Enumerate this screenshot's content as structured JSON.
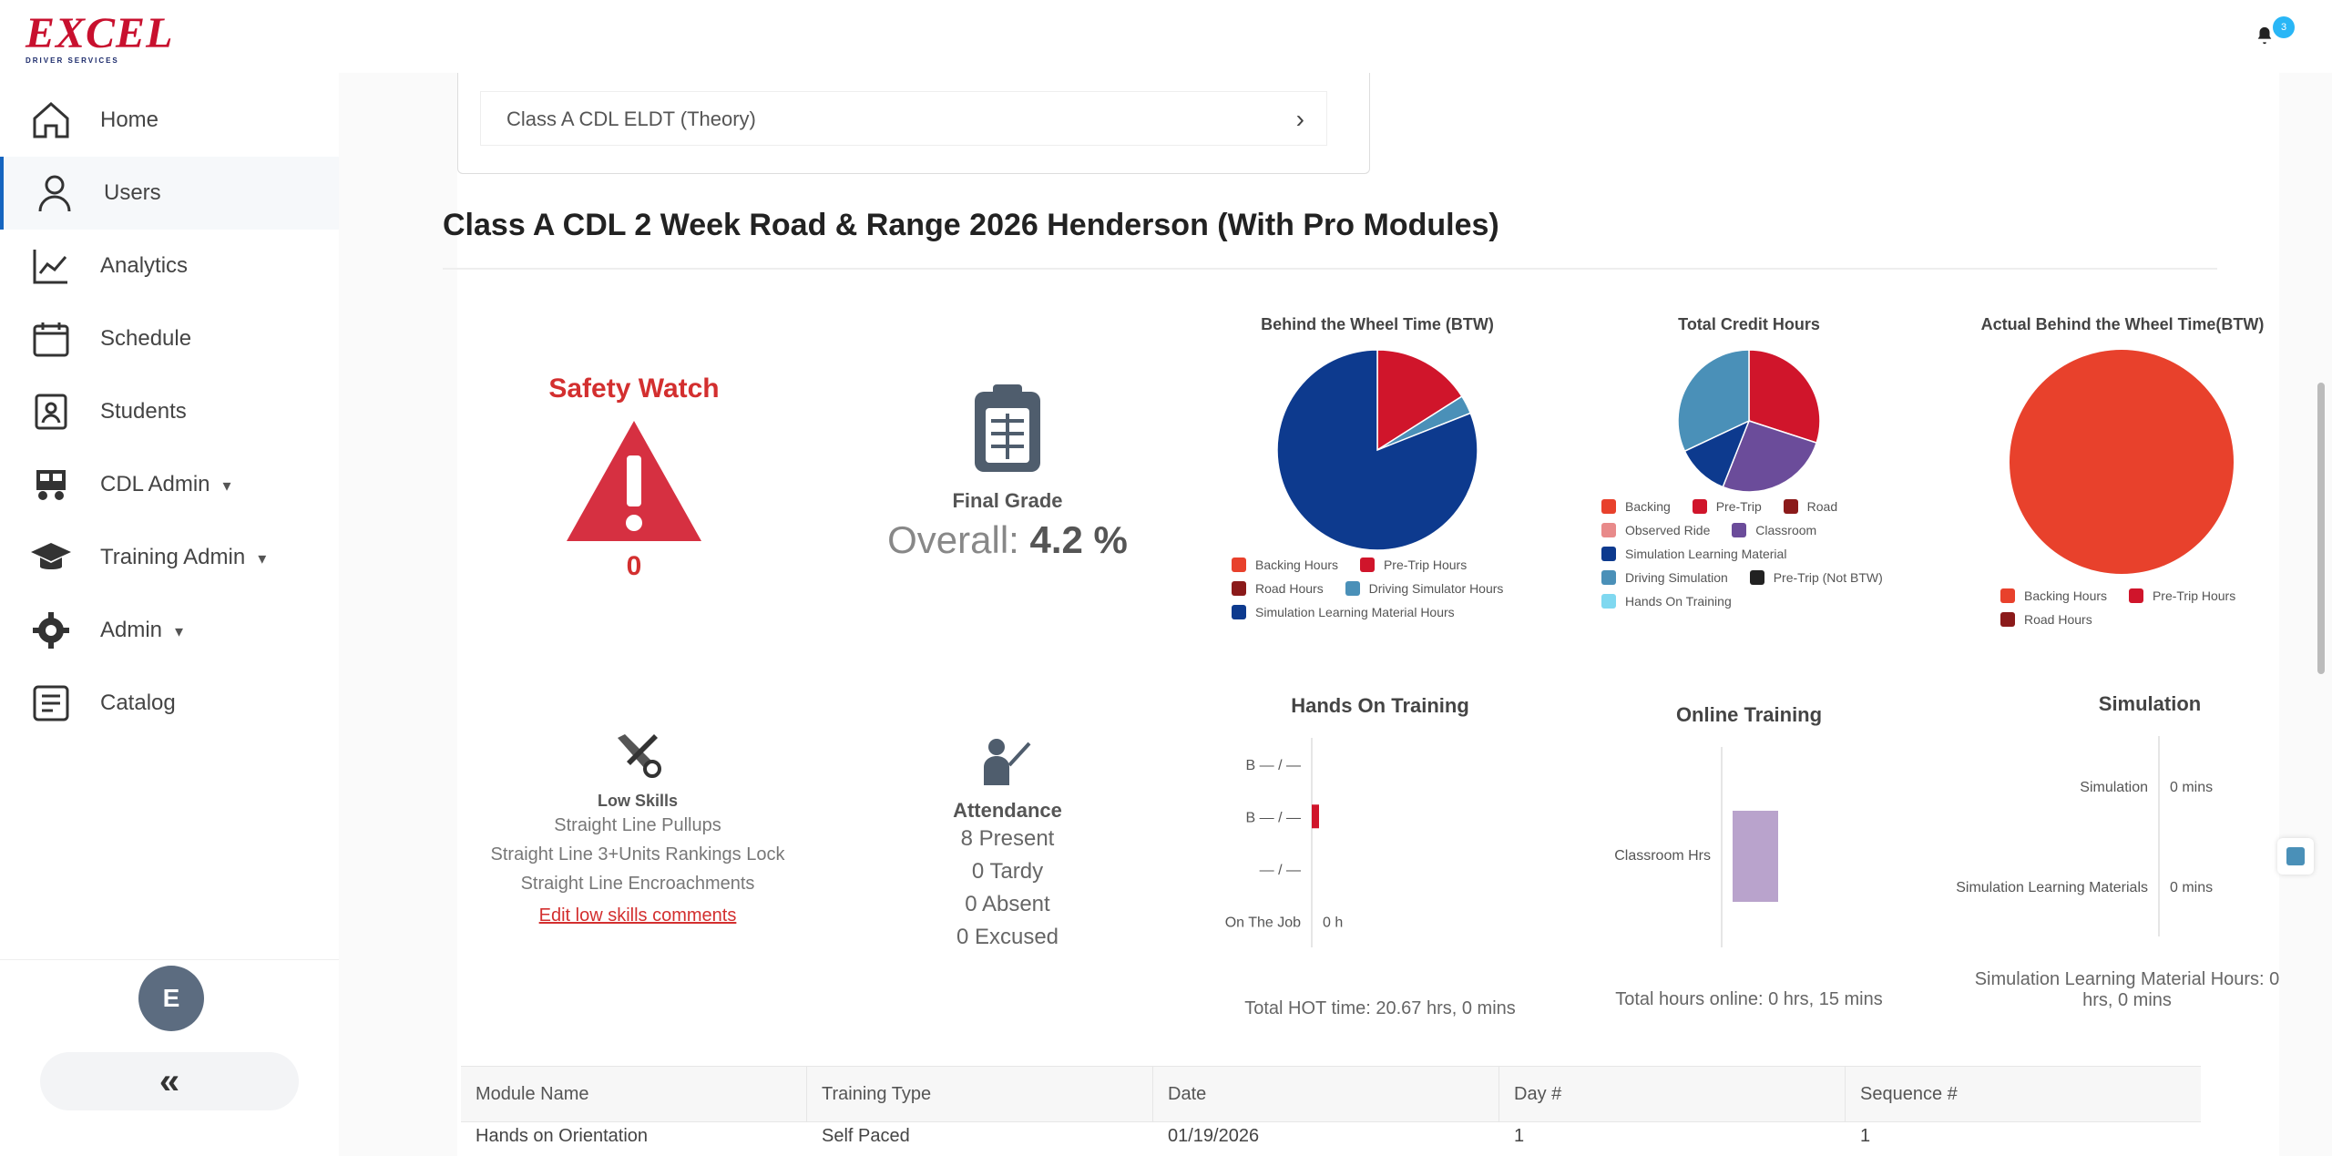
{
  "header": {
    "logo_text": "EXCEL",
    "logo_sub": "DRIVER SERVICES",
    "notification_count": "3"
  },
  "sidebar": {
    "items": [
      {
        "label": "Home",
        "icon": "home-icon"
      },
      {
        "label": "Users",
        "icon": "user-icon",
        "active": true
      },
      {
        "label": "Analytics",
        "icon": "analytics-icon"
      },
      {
        "label": "Schedule",
        "icon": "calendar-icon"
      },
      {
        "label": "Students",
        "icon": "students-icon"
      },
      {
        "label": "CDL Admin",
        "icon": "truck-icon",
        "caret": "▾"
      },
      {
        "label": "Training Admin",
        "icon": "graduation-cap-icon",
        "caret": "▾"
      },
      {
        "label": "Admin",
        "icon": "gear-icon",
        "caret": "▾"
      },
      {
        "label": "Catalog",
        "icon": "catalog-icon"
      }
    ],
    "avatar_initial": "E",
    "collapse_glyph": "«"
  },
  "previous_course": {
    "item_label": "Class A CDL ELDT (Theory)",
    "chevron": "›"
  },
  "course": {
    "title": "Class A CDL 2 Week Road & Range 2026 Henderson (With Pro Modules)"
  },
  "safety": {
    "title": "Safety Watch",
    "count": "0"
  },
  "final_grade": {
    "label": "Final Grade",
    "overall_prefix": "Overall:",
    "overall_value": "4.2 %"
  },
  "low_skills": {
    "title": "Low Skills",
    "lines": [
      "Straight Line Pullups",
      "Straight Line 3+Units Rankings Lock",
      "Straight Line Encroachments"
    ],
    "link": "Edit low skills comments"
  },
  "attendance": {
    "title": "Attendance",
    "present": "8 Present",
    "tardy": "0 Tardy",
    "absent": "0 Absent",
    "excused": "0 Excused"
  },
  "pies": [
    {
      "title": "Behind the Wheel Time (BTW)",
      "legend": [
        {
          "label": "Backing Hours",
          "color": "#e8412c"
        },
        {
          "label": "Pre-Trip Hours",
          "color": "#d0152b"
        },
        {
          "label": "Road Hours",
          "color": "#8b1a1a"
        },
        {
          "label": "Driving Simulator Hours",
          "color": "#4a90b8"
        },
        {
          "label": "Simulation Learning Material Hours",
          "color": "#0d3a8e"
        }
      ]
    },
    {
      "title": "Total Credit Hours",
      "legend": [
        {
          "label": "Backing",
          "color": "#e8412c"
        },
        {
          "label": "Pre-Trip",
          "color": "#d0152b"
        },
        {
          "label": "Road",
          "color": "#8b1a1a"
        },
        {
          "label": "Observed Ride",
          "color": "#e88a8a"
        },
        {
          "label": "Classroom",
          "color": "#6b4c9a"
        },
        {
          "label": "Simulation Learning Material",
          "color": "#0d3a8e"
        },
        {
          "label": "Driving Simulation",
          "color": "#4a90b8"
        },
        {
          "label": "Pre-Trip (Not BTW)",
          "color": "#222222"
        },
        {
          "label": "Hands On Training",
          "color": "#7fd8f0"
        }
      ]
    },
    {
      "title": "Actual Behind the Wheel Time(BTW)",
      "legend": [
        {
          "label": "Backing Hours",
          "color": "#e8412c"
        },
        {
          "label": "Pre-Trip Hours",
          "color": "#d0152b"
        },
        {
          "label": "Road Hours",
          "color": "#8b1a1a"
        }
      ]
    }
  ],
  "chart_data": [
    {
      "type": "pie",
      "title": "Behind the Wheel Time (BTW)",
      "categories": [
        "Backing Hours",
        "Pre-Trip Hours",
        "Road Hours",
        "Driving Simulator Hours",
        "Simulation Learning Material Hours"
      ],
      "values": [
        0,
        16,
        0,
        3,
        81
      ],
      "colors": [
        "#e8412c",
        "#d0152b",
        "#8b1a1a",
        "#4a90b8",
        "#0d3a8e"
      ]
    },
    {
      "type": "pie",
      "title": "Total Credit Hours",
      "categories": [
        "Backing",
        "Pre-Trip",
        "Road",
        "Observed Ride",
        "Classroom",
        "Simulation Learning Material",
        "Driving Simulation",
        "Pre-Trip (Not BTW)",
        "Hands On Training"
      ],
      "values": [
        0,
        30,
        0,
        0,
        26,
        12,
        32,
        0,
        0
      ],
      "colors": [
        "#e8412c",
        "#d0152b",
        "#8b1a1a",
        "#e88a8a",
        "#6b4c9a",
        "#0d3a8e",
        "#4a90b8",
        "#222222",
        "#7fd8f0"
      ]
    },
    {
      "type": "pie",
      "title": "Actual Behind the Wheel Time(BTW)",
      "categories": [
        "Backing Hours",
        "Pre-Trip Hours",
        "Road Hours"
      ],
      "values": [
        100,
        0,
        0
      ],
      "colors": [
        "#e8412c",
        "#d0152b",
        "#8b1a1a"
      ]
    },
    {
      "type": "bar",
      "title": "Hands On Training",
      "categories": [
        "B — / —",
        "B — / —",
        "— / —",
        "On The Job"
      ],
      "values": [
        0,
        0.3,
        0,
        0
      ],
      "value_labels": [
        "",
        "",
        "",
        "0 h"
      ],
      "colors": [
        "#d0152b"
      ],
      "footer": "Total HOT time: 20.67 hrs, 0 mins"
    },
    {
      "type": "bar",
      "title": "Online Training",
      "categories": [
        "Classroom Hrs"
      ],
      "values": [
        1
      ],
      "colors": [
        "#b9a3cc"
      ],
      "footer": "Total hours online: 0 hrs, 15 mins"
    },
    {
      "type": "bar",
      "title": "Simulation",
      "categories": [
        "Simulation",
        "Simulation Learning Materials"
      ],
      "values": [
        0,
        0
      ],
      "value_labels": [
        "0 mins",
        "0 mins"
      ],
      "footer": "Simulation Learning Material Hours: 0 hrs, 0 mins"
    }
  ],
  "table": {
    "headers": [
      "Module Name",
      "Training Type",
      "Date",
      "Day #",
      "Sequence #"
    ],
    "rows": [
      [
        "Hands on Orientation",
        "Self Paced",
        "01/19/2026",
        "1",
        "1"
      ]
    ]
  }
}
